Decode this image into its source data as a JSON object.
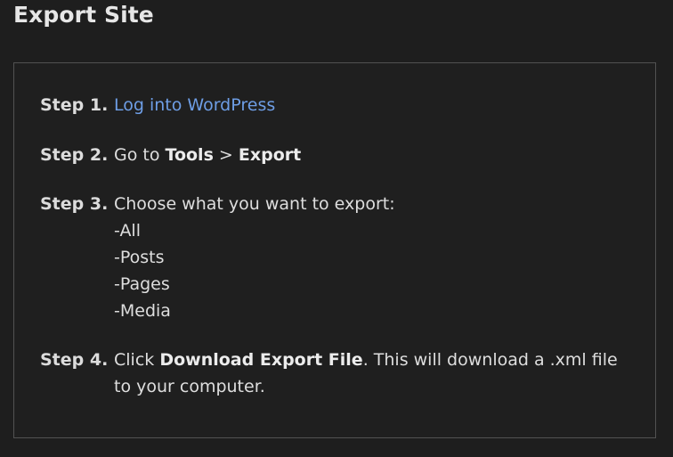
{
  "page": {
    "title": "Export Site"
  },
  "steps": [
    {
      "label": "Step 1.",
      "link_text": "Log into WordPress"
    },
    {
      "label": "Step 2.",
      "text_before": "Go to ",
      "bold_1": "Tools",
      "separator": " > ",
      "bold_2": "Export"
    },
    {
      "label": "Step 3.",
      "text": "Choose what you want to export:",
      "options": [
        "-All",
        "-Posts",
        "-Pages",
        "-Media"
      ]
    },
    {
      "label": "Step 4.",
      "text_before": "Click ",
      "bold": "Download Export File",
      "text_after": ". This will download a .xml file",
      "text_line2": "to your computer."
    }
  ],
  "colors": {
    "background": "#1e1e1e",
    "panel_border": "#525252",
    "link": "#6e9ee6",
    "text": "#dedede"
  }
}
